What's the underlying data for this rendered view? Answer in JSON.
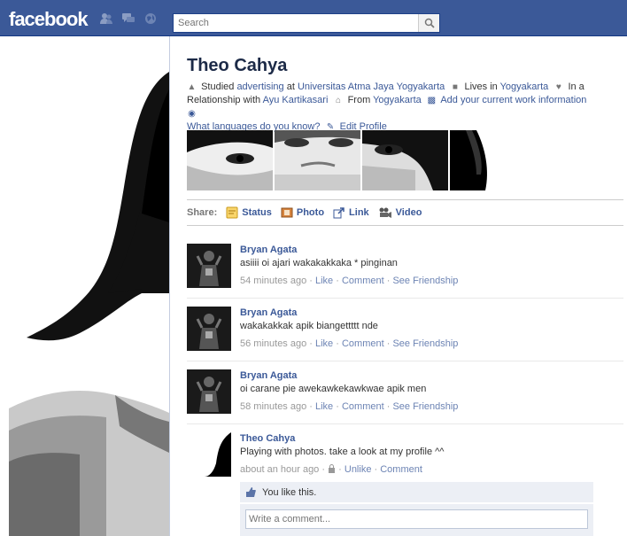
{
  "topbar": {
    "logo": "facebook",
    "search_placeholder": "Search"
  },
  "profile": {
    "name": "Theo Cahya",
    "info": {
      "studied_prefix": "Studied",
      "studied_subject": "advertising",
      "studied_at": "at",
      "school": "Universitas Atma Jaya Yogyakarta",
      "lives_prefix": "Lives in",
      "lives_city": "Yogyakarta",
      "relationship_prefix": "In a Relationship with",
      "partner": "Ayu Kartikasari",
      "from_prefix": "From",
      "from_city": "Yogyakarta",
      "add_work": "Add your current work information",
      "languages": "What languages do you know?",
      "edit_profile": "Edit Profile"
    }
  },
  "share": {
    "label": "Share:",
    "items": [
      "Status",
      "Photo",
      "Link",
      "Video"
    ]
  },
  "posts": [
    {
      "author": "Bryan Agata",
      "message": "asiiii oi ajari wakakakkaka * pinginan",
      "time": "54 minutes ago",
      "actions": [
        "Like",
        "Comment",
        "See Friendship"
      ]
    },
    {
      "author": "Bryan Agata",
      "message": "wakakakkak apik biangettttt nde",
      "time": "56 minutes ago",
      "actions": [
        "Like",
        "Comment",
        "See Friendship"
      ]
    },
    {
      "author": "Bryan Agata",
      "message": "oi carane pie awekawkekawkwae apik men",
      "time": "58 minutes ago",
      "actions": [
        "Like",
        "Comment",
        "See Friendship"
      ]
    },
    {
      "author": "Theo Cahya",
      "message": "Playing with photos. take a look at my profile ^^",
      "time": "about an hour ago",
      "actions": [
        "Unlike",
        "Comment"
      ]
    }
  ],
  "likes_text": "You like this.",
  "comment_placeholder": "Write a comment...",
  "colors": {
    "brand": "#3b5998",
    "link": "#3b5998",
    "meta": "#999999",
    "like_bg": "#eceff5"
  }
}
